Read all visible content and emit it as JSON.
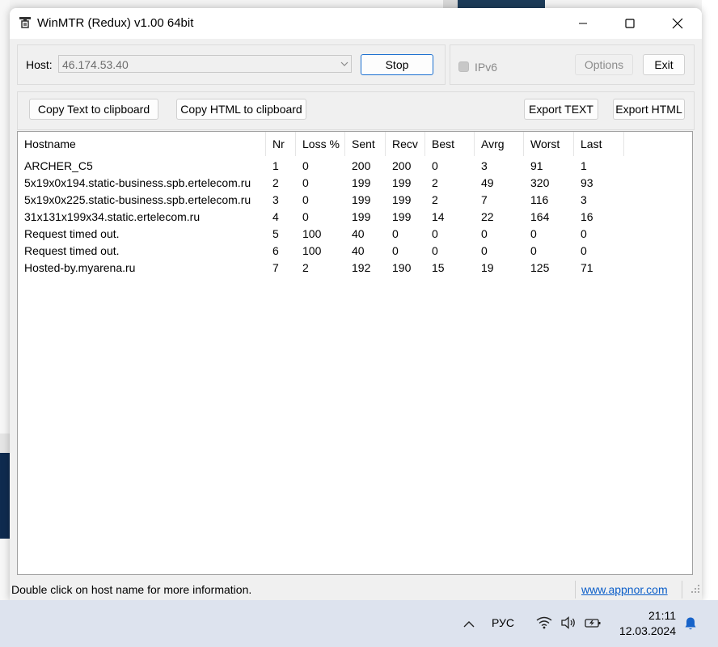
{
  "window": {
    "title": "WinMTR (Redux) v1.00 64bit"
  },
  "controls": {
    "host_label": "Host:",
    "host_value": "46.174.53.40",
    "stop_label": "Stop",
    "ipv6_label": "IPv6",
    "options_label": "Options",
    "exit_label": "Exit",
    "copy_text_label": "Copy Text to clipboard",
    "copy_html_label": "Copy HTML to clipboard",
    "export_text_label": "Export TEXT",
    "export_html_label": "Export HTML"
  },
  "table": {
    "columns": [
      "Hostname",
      "Nr",
      "Loss %",
      "Sent",
      "Recv",
      "Best",
      "Avrg",
      "Worst",
      "Last"
    ],
    "rows": [
      [
        "ARCHER_C5",
        "1",
        "0",
        "200",
        "200",
        "0",
        "3",
        "91",
        "1"
      ],
      [
        "5x19x0x194.static-business.spb.ertelecom.ru",
        "2",
        "0",
        "199",
        "199",
        "2",
        "49",
        "320",
        "93"
      ],
      [
        "5x19x0x225.static-business.spb.ertelecom.ru",
        "3",
        "0",
        "199",
        "199",
        "2",
        "7",
        "116",
        "3"
      ],
      [
        "31x131x199x34.static.ertelecom.ru",
        "4",
        "0",
        "199",
        "199",
        "14",
        "22",
        "164",
        "16"
      ],
      [
        "Request timed out.",
        "5",
        "100",
        "40",
        "0",
        "0",
        "0",
        "0",
        "0"
      ],
      [
        "Request timed out.",
        "6",
        "100",
        "40",
        "0",
        "0",
        "0",
        "0",
        "0"
      ],
      [
        "Hosted-by.myarena.ru",
        "7",
        "2",
        "192",
        "190",
        "15",
        "19",
        "125",
        "71"
      ]
    ]
  },
  "statusbar": {
    "text": "Double click on host name for more information.",
    "link": "www.appnor.com"
  },
  "taskbar": {
    "language": "РУС",
    "time": "21:11",
    "date": "12.03.2024"
  }
}
